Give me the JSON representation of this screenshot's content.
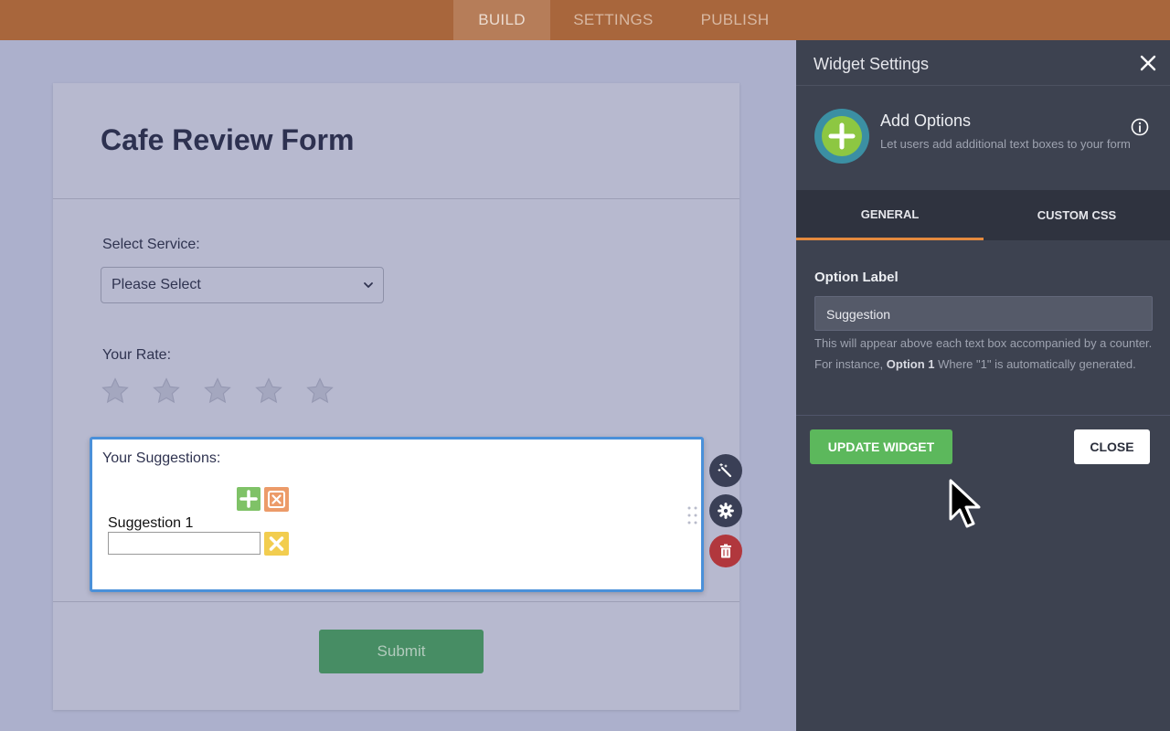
{
  "nav": {
    "tabs": [
      {
        "label": "BUILD",
        "active": true
      },
      {
        "label": "SETTINGS",
        "active": false
      },
      {
        "label": "PUBLISH",
        "active": false
      }
    ]
  },
  "form": {
    "title": "Cafe Review Form",
    "service": {
      "label": "Select Service:",
      "value": "Please Select"
    },
    "rate": {
      "label": "Your Rate:",
      "stars_total": 5,
      "stars_filled": 0
    },
    "suggestions": {
      "label": "Your Suggestions:",
      "items": [
        {
          "label": "Suggestion 1",
          "value": ""
        }
      ]
    },
    "submit_label": "Submit"
  },
  "widget_tools": {
    "icons": [
      "wand-icon",
      "gear-icon",
      "trash-icon"
    ]
  },
  "panel": {
    "title": "Widget Settings",
    "widget": {
      "name": "Add Options",
      "description": "Let users add additional text boxes to your form"
    },
    "tabs": [
      {
        "label": "GENERAL",
        "active": true
      },
      {
        "label": "CUSTOM CSS",
        "active": false
      }
    ],
    "option_label": {
      "label": "Option Label",
      "value": "Suggestion",
      "help_before": "This will appear above each text box accompanied by a counter. For instance, ",
      "help_bold": "Option 1",
      "help_after": " Where \"1\" is automatically generated."
    },
    "update_label": "UPDATE WIDGET",
    "close_label": "CLOSE"
  },
  "colors": {
    "topbar": "#a8663c",
    "panel": "#3d4250",
    "accent": "#e58a3e",
    "update_button": "#5cb85c",
    "submit_button": "#478d64",
    "widget_border": "#4a90d9"
  }
}
